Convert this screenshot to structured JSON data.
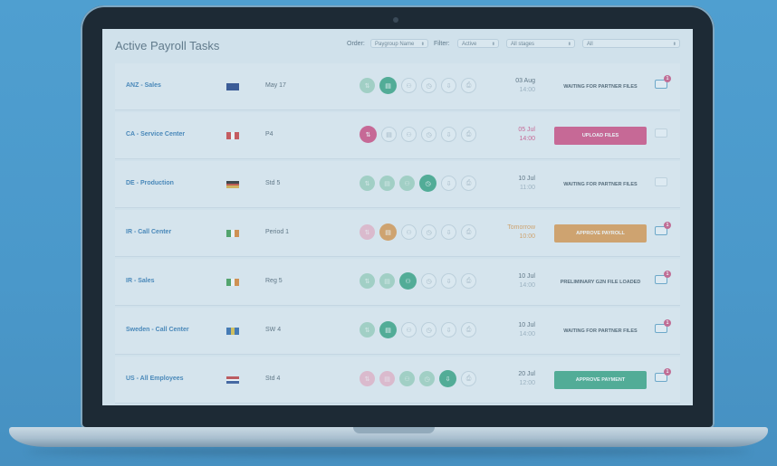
{
  "header": {
    "title": "Active Payroll Tasks",
    "order_label": "Order:",
    "order_value": "Paygroup Name",
    "filter_label": "Filter:",
    "filter_value": "Active",
    "stage_value": "All stages",
    "all_value": "All"
  },
  "colors": {
    "green": "#49ab8b",
    "pink": "#d65a8a",
    "orange": "#e0a05c",
    "blue": "#3e7fb5"
  },
  "rows": [
    {
      "name": "ANZ - Sales",
      "flag": "au",
      "period": "May 17",
      "steps": [
        "done",
        "cur-green",
        "todo",
        "todo",
        "todo",
        "todo"
      ],
      "date": "03 Aug",
      "time": "14:00",
      "date_color": "normal",
      "status": "WAITING FOR PARTNER FILES",
      "status_style": "text",
      "chat_badge": "1",
      "chat_on": true
    },
    {
      "name": "CA - Service Center",
      "flag": "ca",
      "period": "P4",
      "steps": [
        "cur-pink",
        "todo",
        "todo",
        "todo",
        "todo",
        "todo"
      ],
      "date": "05 Jul",
      "time": "14:00",
      "date_color": "pink",
      "status": "UPLOAD FILES",
      "status_style": "pink",
      "chat_badge": "",
      "chat_on": false
    },
    {
      "name": "DE - Production",
      "flag": "de",
      "period": "Std 5",
      "steps": [
        "done",
        "done",
        "done",
        "cur-green",
        "todo",
        "todo"
      ],
      "date": "10 Jul",
      "time": "11:00",
      "date_color": "normal",
      "status": "WAITING FOR PARTNER FILES",
      "status_style": "text",
      "chat_badge": "",
      "chat_on": false
    },
    {
      "name": "IR - Call Center",
      "flag": "ie",
      "period": "Period 1",
      "steps": [
        "done-pink",
        "cur-orange",
        "todo",
        "todo",
        "todo",
        "todo"
      ],
      "date": "Tomorrow",
      "time": "10:00",
      "date_color": "orange",
      "status": "APPROVE PAYROLL",
      "status_style": "orange",
      "chat_badge": "1",
      "chat_on": true
    },
    {
      "name": "IR - Sales",
      "flag": "ie",
      "period": "Reg 5",
      "steps": [
        "done",
        "done",
        "cur-green",
        "todo",
        "todo",
        "todo"
      ],
      "date": "10 Jul",
      "time": "14:00",
      "date_color": "normal",
      "status": "PRELIMINARY G2N FILE LOADED",
      "status_style": "text",
      "chat_badge": "1",
      "chat_on": true
    },
    {
      "name": "Sweden - Call Center",
      "flag": "se",
      "period": "SW 4",
      "steps": [
        "done",
        "cur-green",
        "todo",
        "todo",
        "todo",
        "todo"
      ],
      "date": "10 Jul",
      "time": "14:00",
      "date_color": "normal",
      "status": "WAITING FOR PARTNER FILES",
      "status_style": "text",
      "chat_badge": "1",
      "chat_on": true
    },
    {
      "name": "US - All Employees",
      "flag": "us",
      "period": "Std 4",
      "steps": [
        "done-pink",
        "done-pink",
        "done",
        "done",
        "cur-green",
        "todo"
      ],
      "date": "20 Jul",
      "time": "12:00",
      "date_color": "normal",
      "status": "APPROVE PAYMENT",
      "status_style": "green",
      "chat_badge": "1",
      "chat_on": true
    }
  ]
}
